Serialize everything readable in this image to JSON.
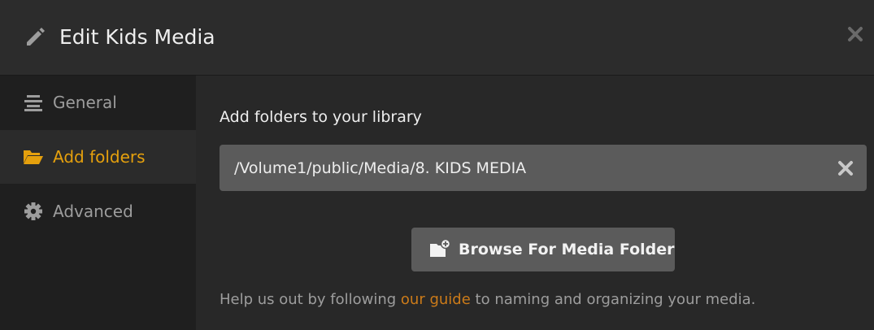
{
  "header": {
    "title": "Edit Kids Media",
    "edit_icon": "pencil-icon",
    "close_icon": "close-icon"
  },
  "sidebar": {
    "items": [
      {
        "label": "General",
        "icon": "align-center-icon",
        "active": false
      },
      {
        "label": "Add folders",
        "icon": "folder-open-icon",
        "active": true
      },
      {
        "label": "Advanced",
        "icon": "gear-icon",
        "active": false
      }
    ]
  },
  "main": {
    "section_title": "Add folders to your library",
    "folders": [
      {
        "path": "/Volume1/public/Media/8. KIDS MEDIA",
        "remove_icon": "remove-x-icon"
      }
    ],
    "browse_button": {
      "label": "Browse For Media Folder",
      "icon": "folder-add-icon"
    },
    "help": {
      "prefix": "Help us out by following ",
      "link": "our guide",
      "suffix": " to naming and organizing your media."
    }
  },
  "colors": {
    "accent": "#e5a00d",
    "link": "#cc7b19",
    "background": "#282828",
    "sidebar_background": "#1f1f1f",
    "field_background": "#5b5b5b"
  }
}
